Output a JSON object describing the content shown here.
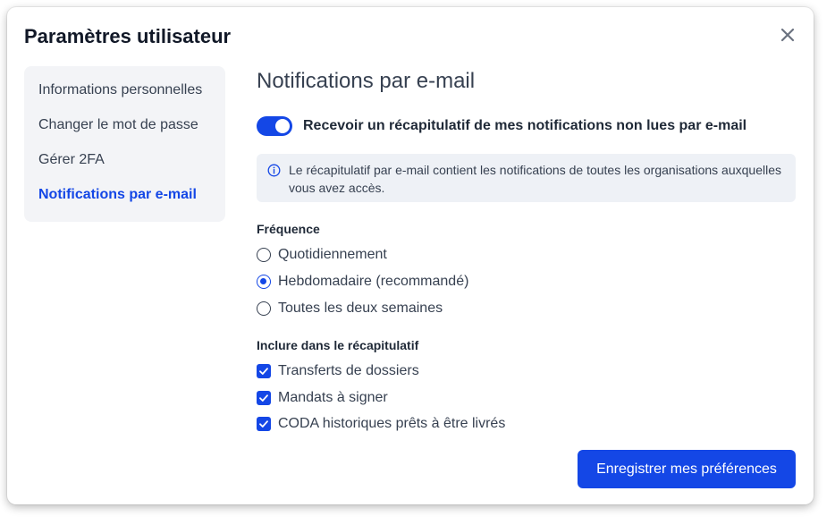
{
  "modal": {
    "title": "Paramètres utilisateur",
    "close_icon": "close-icon"
  },
  "sidebar": {
    "items": [
      {
        "label": "Informations personnelles",
        "active": false
      },
      {
        "label": "Changer le mot de passe",
        "active": false
      },
      {
        "label": "Gérer 2FA",
        "active": false
      },
      {
        "label": "Notifications par e-mail",
        "active": true
      }
    ]
  },
  "content": {
    "title": "Notifications par e-mail",
    "digest_toggle": {
      "label": "Recevoir un récapitulatif de mes notifications non lues par e-mail",
      "on": true
    },
    "info": {
      "icon": "info-icon",
      "text": "Le récapitulatif par e-mail contient les notifications de toutes les organisations auxquelles vous avez accès."
    },
    "frequency": {
      "label": "Fréquence",
      "options": [
        {
          "label": "Quotidiennement",
          "checked": false
        },
        {
          "label": "Hebdomadaire (recommandé)",
          "checked": true
        },
        {
          "label": "Toutes les deux semaines",
          "checked": false
        }
      ]
    },
    "include": {
      "label": "Inclure dans le récapitulatif",
      "options": [
        {
          "label": "Transferts de dossiers",
          "checked": true
        },
        {
          "label": "Mandats à signer",
          "checked": true
        },
        {
          "label": "CODA historiques prêts à être livrés",
          "checked": true
        }
      ]
    },
    "save_label": "Enregistrer mes préférences"
  },
  "colors": {
    "accent": "#1447e6",
    "sidebar_bg": "#f3f4f7",
    "info_bg": "#eef1f6"
  }
}
